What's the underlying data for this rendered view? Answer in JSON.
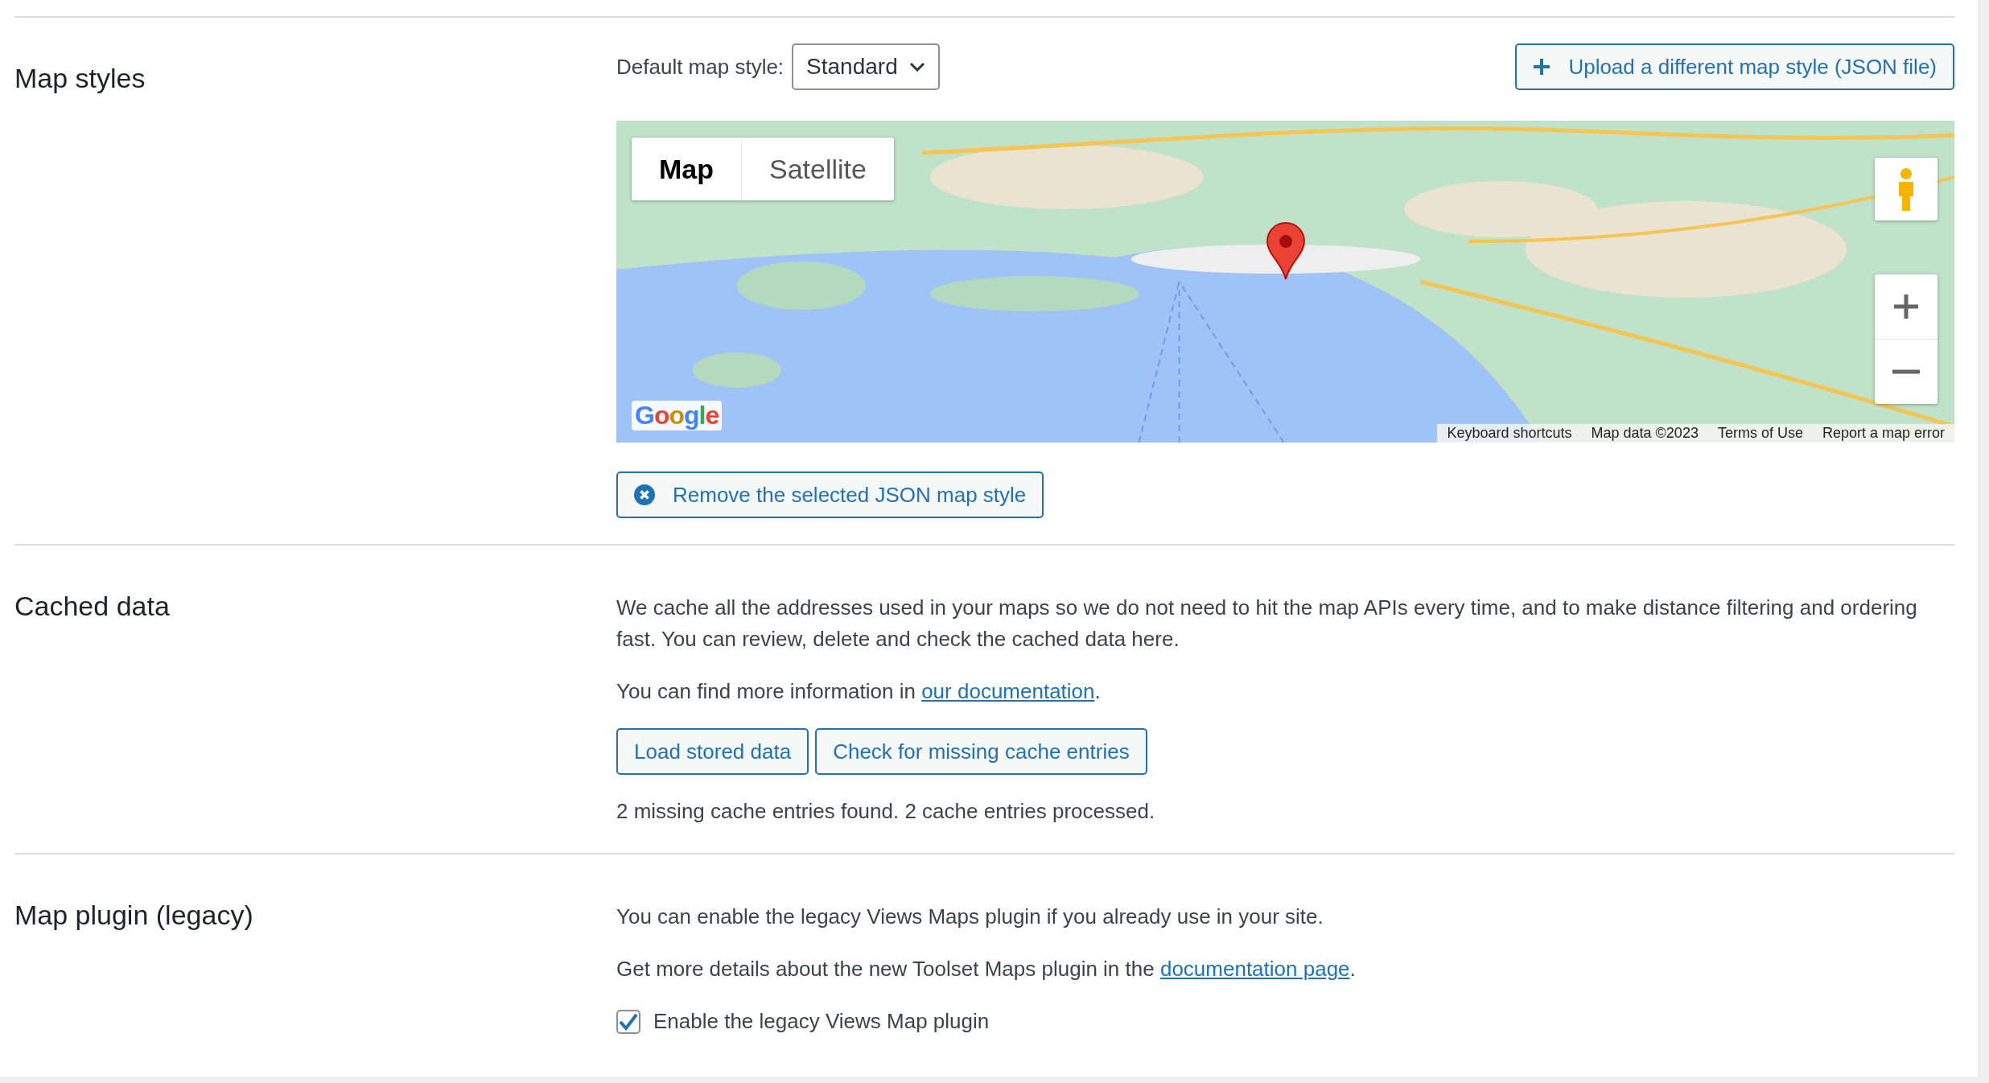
{
  "map_styles": {
    "title": "Map styles",
    "default_style": {
      "label": "Default map style:",
      "value": "Standard"
    },
    "upload_button": "Upload a different map style (JSON file)",
    "map": {
      "tabs": [
        {
          "label": "Map",
          "selected": true
        },
        {
          "label": "Satellite",
          "selected": false
        }
      ],
      "logo": "Google",
      "attribution": [
        "Keyboard shortcuts",
        "Map data ©2023",
        "Terms of Use",
        "Report a map error"
      ]
    },
    "remove_button": "Remove the selected JSON map style"
  },
  "cached_data": {
    "title": "Cached data",
    "description": "We cache all the addresses used in your maps so we do not need to hit the map APIs every time, and to make distance filtering and ordering fast. You can review, delete and check the cached data here.",
    "info": {
      "before": "You can find more information in ",
      "link": "our documentation",
      "after": "."
    },
    "buttons": [
      "Load stored data",
      "Check for missing cache entries"
    ],
    "status": "2 missing cache entries found. 2 cache entries processed."
  },
  "map_plugin": {
    "title": "Map plugin (legacy)",
    "description": "You can enable the legacy Views Maps plugin if you already use in your site.",
    "info": {
      "before": "Get more details about the new Toolset Maps plugin in the ",
      "link": "documentation page",
      "after": "."
    },
    "checkbox": {
      "label": "Enable the legacy Views Map plugin",
      "checked": true
    }
  }
}
